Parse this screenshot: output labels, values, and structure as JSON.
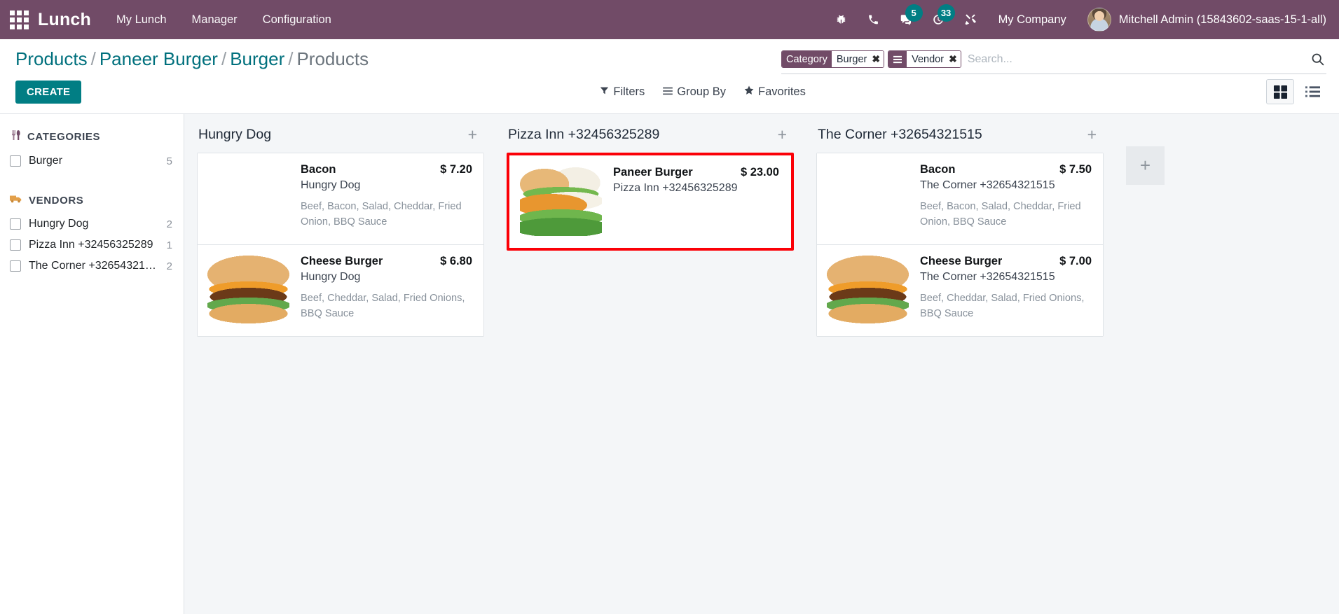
{
  "navbar": {
    "apps_icon": "apps-grid-icon",
    "brand": "Lunch",
    "menu": [
      {
        "label": "My Lunch"
      },
      {
        "label": "Manager"
      },
      {
        "label": "Configuration"
      }
    ],
    "icons": [
      {
        "name": "bug-icon",
        "badge": null
      },
      {
        "name": "phone-icon",
        "badge": null
      },
      {
        "name": "messages-icon",
        "badge": "5"
      },
      {
        "name": "activities-clock-icon",
        "badge": "33"
      },
      {
        "name": "tools-icon",
        "badge": null
      }
    ],
    "company": "My Company",
    "user": "Mitchell Admin (15843602-saas-15-1-all)",
    "brand_color": "#714B67",
    "badge_color": "#017e84"
  },
  "control_panel": {
    "breadcrumb": [
      {
        "label": "Products",
        "current": false
      },
      {
        "label": "Paneer Burger",
        "current": false
      },
      {
        "label": "Burger",
        "current": false
      },
      {
        "label": "Products",
        "current": true
      }
    ],
    "separator": "/",
    "create_label": "CREATE",
    "search": {
      "placeholder": "Search...",
      "facets": [
        {
          "label": "Category",
          "icon": null,
          "value": "Burger",
          "remove": "✖"
        },
        {
          "label": "",
          "icon": "group-by-icon",
          "value": "Vendor",
          "remove": "✖"
        }
      ],
      "magnifier_icon": "search-icon"
    },
    "dropdowns": [
      {
        "label": "Filters",
        "icon": "filter-icon"
      },
      {
        "label": "Group By",
        "icon": "group-by-icon"
      },
      {
        "label": "Favorites",
        "icon": "star-icon"
      }
    ],
    "views": [
      {
        "name": "kanban-view",
        "icon": "kanban-icon",
        "active": true
      },
      {
        "name": "list-view",
        "icon": "list-icon",
        "active": false
      }
    ],
    "link_color": "#00707d",
    "create_color": "#017e84"
  },
  "sidebar": {
    "categories": {
      "title": "CATEGORIES",
      "icon": "cutlery-icon",
      "items": [
        {
          "label": "Burger",
          "count": "5",
          "checked": false
        }
      ]
    },
    "vendors": {
      "title": "VENDORS",
      "icon": "truck-icon",
      "items": [
        {
          "label": "Hungry Dog",
          "count": "2",
          "checked": false
        },
        {
          "label": "Pizza Inn +32456325289",
          "count": "1",
          "checked": false
        },
        {
          "label": "The Corner +326543215…",
          "count": "2",
          "checked": false
        }
      ]
    }
  },
  "kanban": {
    "add_column_label": "+",
    "columns": [
      {
        "title": "Hungry Dog",
        "add_label": "+",
        "highlight": false,
        "cards": [
          {
            "name": "Bacon",
            "price": "$ 7.20",
            "vendor": "Hungry Dog",
            "description": "Beef, Bacon, Salad, Cheddar, Fried Onion, BBQ Sauce",
            "image": "bacon-burger-image"
          },
          {
            "name": "Cheese Burger",
            "price": "$ 6.80",
            "vendor": "Hungry Dog",
            "description": "Beef, Cheddar, Salad, Fried Onions, BBQ Sauce",
            "image": "cheese-burger-image"
          }
        ]
      },
      {
        "title": "Pizza Inn +32456325289",
        "add_label": "+",
        "highlight": true,
        "cards": [
          {
            "name": "Paneer Burger",
            "price": "$ 23.00",
            "vendor": "Pizza Inn +32456325289",
            "description": "",
            "image": "paneer-burger-image"
          }
        ]
      },
      {
        "title": "The Corner +32654321515",
        "add_label": "+",
        "highlight": false,
        "cards": [
          {
            "name": "Bacon",
            "price": "$ 7.50",
            "vendor": "The Corner +32654321515",
            "description": "Beef, Bacon, Salad, Cheddar, Fried Onion, BBQ Sauce",
            "image": "bacon-burger-image"
          },
          {
            "name": "Cheese Burger",
            "price": "$ 7.00",
            "vendor": "The Corner +32654321515",
            "description": "Beef, Cheddar, Salad, Fried Onions, BBQ Sauce",
            "image": "cheese-burger-image"
          }
        ]
      }
    ],
    "highlight_color": "#fb0007"
  }
}
